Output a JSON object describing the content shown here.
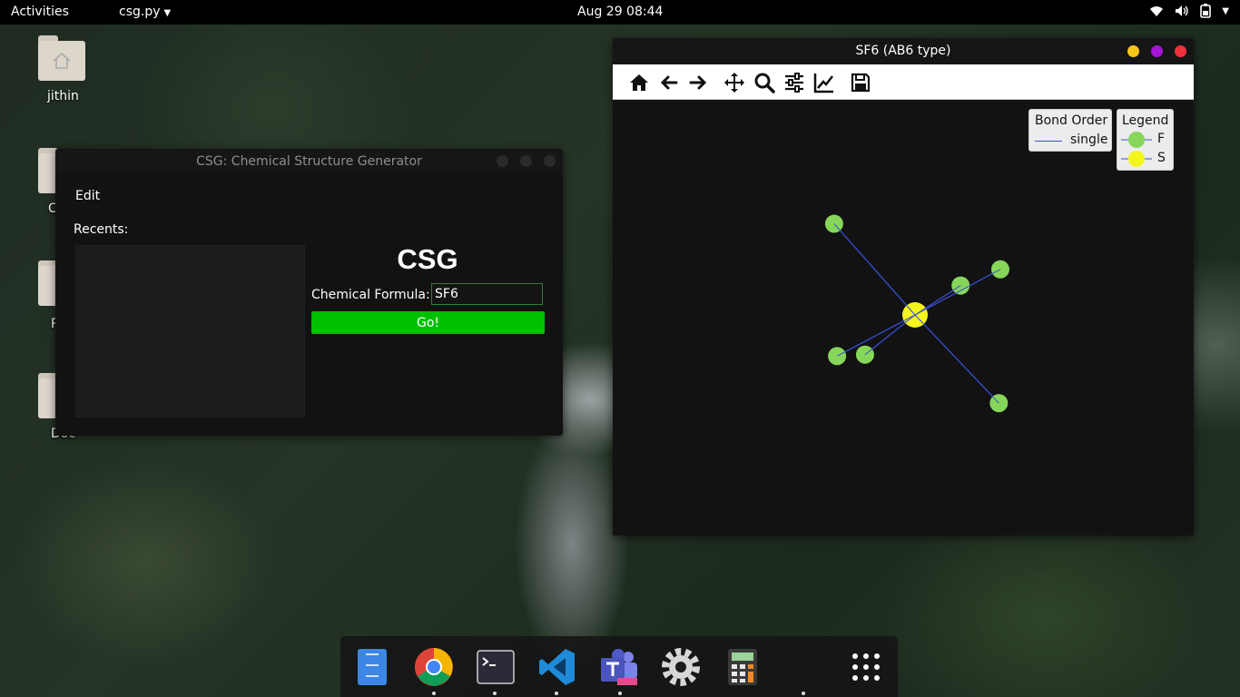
{
  "topbar": {
    "activities": "Activities",
    "app_menu": "csg.py",
    "clock": "Aug 29  08:44"
  },
  "desktop": {
    "home_label": "jithin",
    "partial_labels": [
      "C",
      "P",
      "Doc"
    ]
  },
  "csg_window": {
    "title": "CSG: Chemical Structure Generator",
    "menu_edit": "Edit",
    "recents_label": "Recents:",
    "brand": "CSG",
    "formula_label": "Chemical Formula:",
    "formula_value": "SF6",
    "go_label": "Go!"
  },
  "plot_window": {
    "title": "SF6 (AB6 type)",
    "toolbar": [
      "home-icon",
      "back-arrow-icon",
      "forward-arrow-icon",
      "pan-icon",
      "zoom-icon",
      "configure-subplots-icon",
      "edit-axes-icon",
      "save-icon"
    ],
    "bond_legend": {
      "title": "Bond Order",
      "entry": "single",
      "line_color": "#3a4fd0"
    },
    "atom_legend": {
      "title": "Legend",
      "entries": [
        {
          "label": "F",
          "color": "#86d65a"
        },
        {
          "label": "S",
          "color": "#f5f51e"
        }
      ]
    },
    "background": "#121212"
  },
  "chart_data": {
    "type": "scatter",
    "title": "",
    "xlabel": "",
    "ylabel": "",
    "grid": false,
    "axes_visible": false,
    "xlim": [
      -1.2,
      1.2
    ],
    "ylim": [
      -1.2,
      1.2
    ],
    "atoms": [
      {
        "element": "S",
        "x": 0.0,
        "y": 0.0,
        "color": "#f5f51e"
      },
      {
        "element": "F",
        "x": -0.55,
        "y": 0.62,
        "color": "#86d65a"
      },
      {
        "element": "F",
        "x": 0.57,
        "y": -0.6,
        "color": "#86d65a"
      },
      {
        "element": "F",
        "x": 0.58,
        "y": 0.31,
        "color": "#86d65a"
      },
      {
        "element": "F",
        "x": -0.53,
        "y": -0.28,
        "color": "#86d65a"
      },
      {
        "element": "F",
        "x": 0.31,
        "y": 0.2,
        "color": "#86d65a"
      },
      {
        "element": "F",
        "x": -0.34,
        "y": -0.27,
        "color": "#86d65a"
      }
    ],
    "bonds": [
      {
        "from": 0,
        "to": 1,
        "order": "single"
      },
      {
        "from": 0,
        "to": 2,
        "order": "single"
      },
      {
        "from": 0,
        "to": 3,
        "order": "single"
      },
      {
        "from": 0,
        "to": 4,
        "order": "single"
      },
      {
        "from": 0,
        "to": 5,
        "order": "single"
      },
      {
        "from": 0,
        "to": 6,
        "order": "single"
      }
    ],
    "legend_placement": "top-right"
  },
  "dock": {
    "apps": [
      "files-icon",
      "chrome-icon",
      "terminal-icon",
      "vscode-icon",
      "teams-icon",
      "settings-icon",
      "calculator-icon",
      "blank-app-icon",
      "app-grid-icon"
    ]
  },
  "colors": {
    "go_button": "#00c000",
    "close": "#f0323c",
    "minimize": "#f5c518",
    "maximize": "#a515d6"
  }
}
